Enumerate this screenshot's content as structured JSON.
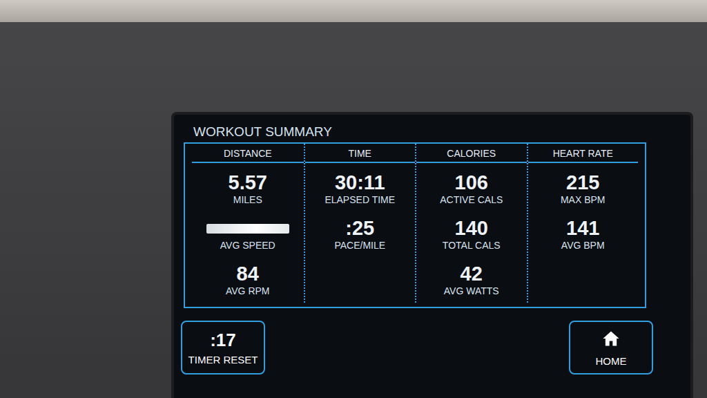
{
  "screen": {
    "title": "WORKOUT SUMMARY"
  },
  "columns": [
    {
      "header": "DISTANCE",
      "metrics": [
        {
          "value": "5.57",
          "label": "MILES",
          "obscured": false
        },
        {
          "value": "",
          "label": "AVG SPEED",
          "obscured": true
        },
        {
          "value": "84",
          "label": "AVG RPM",
          "obscured": false
        }
      ]
    },
    {
      "header": "TIME",
      "metrics": [
        {
          "value": "30:11",
          "label": "ELAPSED TIME",
          "obscured": false
        },
        {
          "value": ":25",
          "label": "PACE/MILE",
          "obscured": false
        }
      ]
    },
    {
      "header": "CALORIES",
      "metrics": [
        {
          "value": "106",
          "label": "ACTIVE CALS",
          "obscured": false
        },
        {
          "value": "140",
          "label": "TOTAL CALS",
          "obscured": false
        },
        {
          "value": "42",
          "label": "AVG WATTS",
          "obscured": false
        }
      ]
    },
    {
      "header": "HEART RATE",
      "metrics": [
        {
          "value": "215",
          "label": "MAX BPM",
          "obscured": false
        },
        {
          "value": "141",
          "label": "AVG BPM",
          "obscured": false
        }
      ]
    }
  ],
  "buttons": [
    {
      "kind": "timer",
      "value": ":17",
      "label": "TIMER RESET"
    },
    {
      "kind": "home",
      "value": "",
      "label": "HOME"
    }
  ]
}
